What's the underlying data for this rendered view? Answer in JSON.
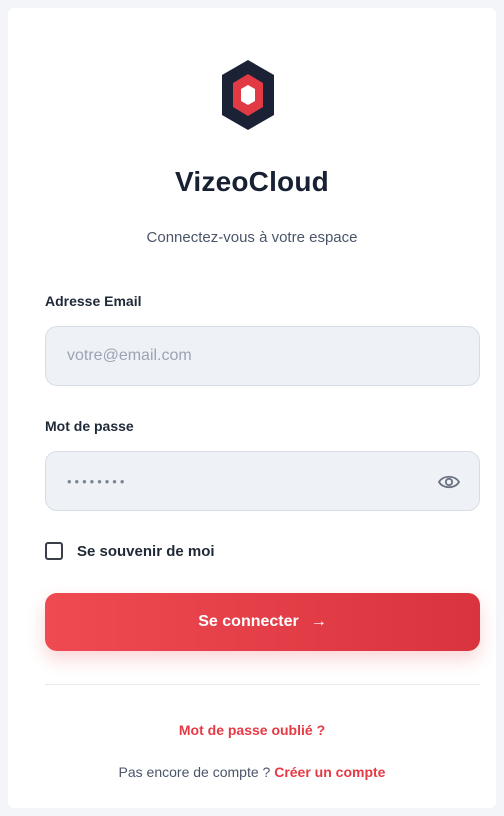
{
  "brand": {
    "name": "VizeoCloud",
    "subtitle": "Connectez-vous à votre espace",
    "logo_icon": "hexagon-logo-icon",
    "logo_colors": {
      "outer": "#1b2235",
      "ring": "#e23a44",
      "inner": "#ffffff"
    }
  },
  "email": {
    "label": "Adresse Email",
    "placeholder": "votre@email.com",
    "value": ""
  },
  "password": {
    "label": "Mot de passe",
    "value": "••••••••",
    "toggle_icon": "eye-icon"
  },
  "remember": {
    "label": "Se souvenir de moi",
    "checked": false
  },
  "submit": {
    "label": "Se connecter",
    "arrow": "→",
    "icon": "arrow-right-icon"
  },
  "forgot_link": "Mot de passe oublié ?",
  "signup": {
    "prompt": "Pas encore de compte ?",
    "link": "Créer un compte"
  },
  "colors": {
    "accent": "#e23a44",
    "text_dark": "#182033",
    "input_bg": "#eef2f7"
  }
}
